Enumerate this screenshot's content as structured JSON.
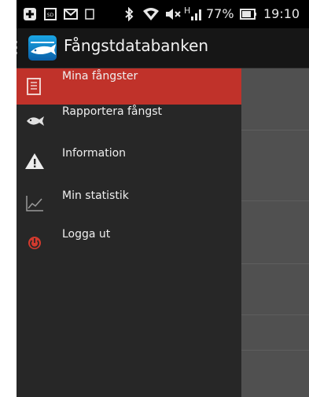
{
  "status_bar": {
    "battery_percent": "77%",
    "time": "19:10",
    "signal_label": "H",
    "icons": [
      "plus-icon",
      "sd-card-icon",
      "mail-icon",
      "notification-icon",
      "bluetooth-icon",
      "wifi-icon",
      "mute-icon",
      "signal-icon",
      "battery-icon"
    ]
  },
  "action_bar": {
    "title": "Fångstdatabanken",
    "logo_icon": "app-logo-icon"
  },
  "drawer": {
    "items": [
      {
        "label": "Mina fångster",
        "icon": "list-icon",
        "active": true
      },
      {
        "label": "Rapportera fångst",
        "icon": "fish-icon",
        "active": false
      },
      {
        "label": "Information",
        "icon": "warning-icon",
        "active": false
      },
      {
        "label": "Min statistik",
        "icon": "chart-icon",
        "active": false
      },
      {
        "label": "Logga ut",
        "icon": "power-icon",
        "active": false
      }
    ]
  },
  "colors": {
    "active_item": "#c0322a",
    "drawer_bg": "#272727",
    "overlay_bg": "#505050"
  }
}
